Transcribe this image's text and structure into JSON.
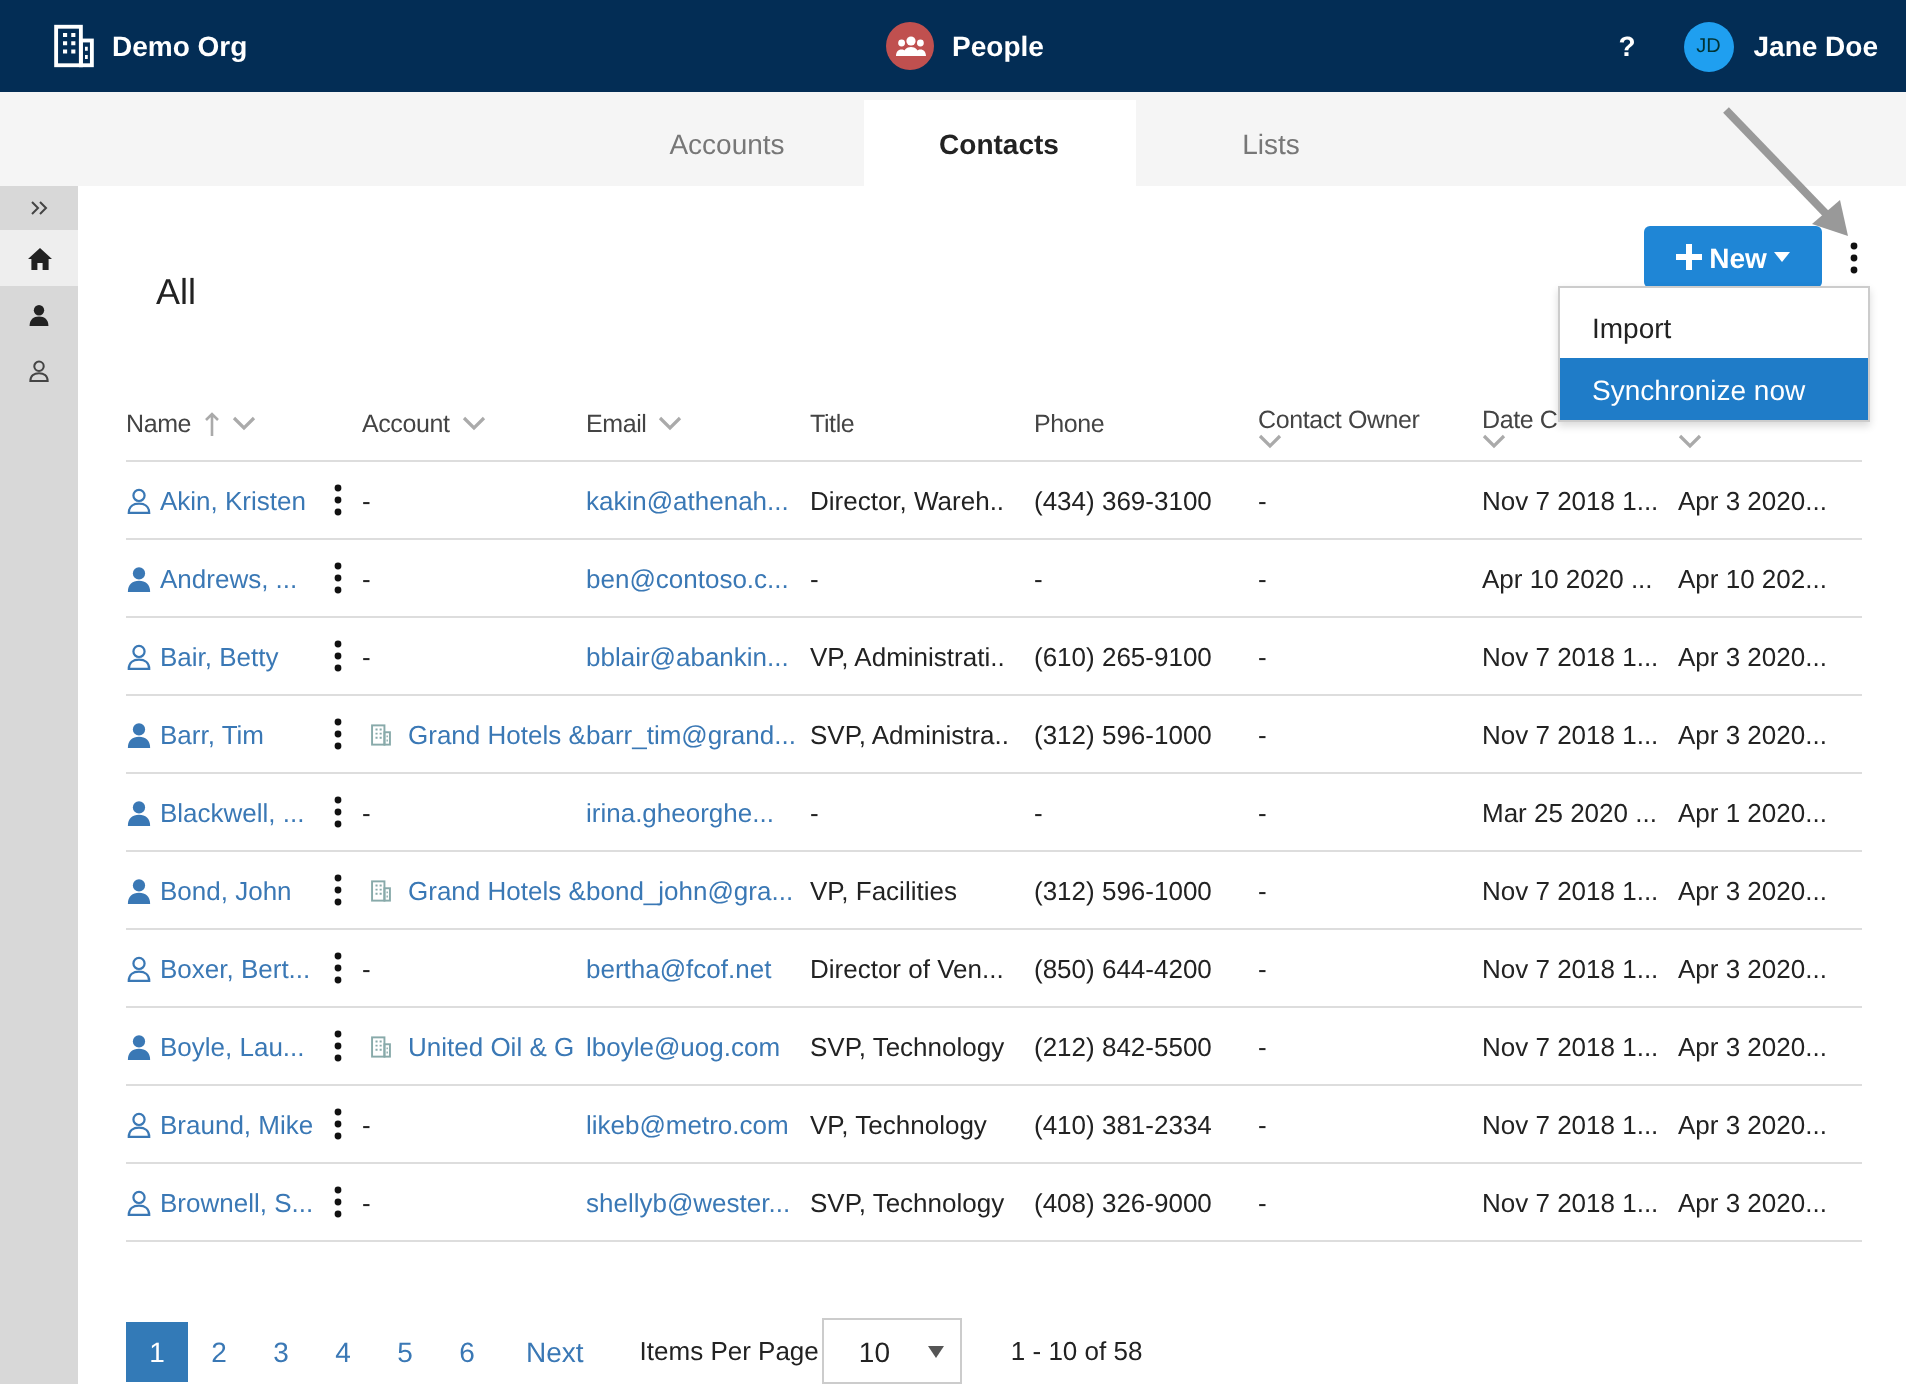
{
  "header": {
    "org": "Demo Org",
    "app": "People",
    "help": "?",
    "user": {
      "initials": "JD",
      "name": "Jane Doe"
    }
  },
  "tabs": [
    {
      "label": "Accounts",
      "selected": false
    },
    {
      "label": "Contacts",
      "selected": true
    },
    {
      "label": "Lists",
      "selected": false
    }
  ],
  "sidebar": {
    "items": [
      {
        "kind": "expand",
        "selected": false
      },
      {
        "kind": "home",
        "selected": true
      },
      {
        "kind": "person",
        "selected": false
      },
      {
        "kind": "person-outline",
        "selected": false
      }
    ]
  },
  "view_title": "All",
  "new_button": "New",
  "more_menu": {
    "items": [
      {
        "label": "Import",
        "selected": false
      },
      {
        "label": "Synchronize now",
        "selected": true
      }
    ]
  },
  "table": {
    "columns": [
      {
        "label": "Name",
        "sorted_ascending": true,
        "menu": true,
        "stacked": false
      },
      {
        "label": "Account",
        "sorted_ascending": false,
        "menu": true,
        "stacked": false
      },
      {
        "label": "Email",
        "sorted_ascending": false,
        "menu": true,
        "stacked": false
      },
      {
        "label": "Title",
        "sorted_ascending": false,
        "menu": false,
        "stacked": false
      },
      {
        "label": "Phone",
        "sorted_ascending": false,
        "menu": false,
        "stacked": false
      },
      {
        "label": "Contact Owner",
        "sorted_ascending": false,
        "menu": true,
        "stacked": true
      },
      {
        "label": "Date C",
        "sorted_ascending": false,
        "menu": true,
        "stacked": true
      },
      {
        "sorted_ascending": false,
        "menu": true,
        "stacked": true
      }
    ],
    "rows": [
      {
        "kind": "outline",
        "name": "Akin, Kristen",
        "account": "-",
        "account_linked": false,
        "email": "kakin@athenah...",
        "title": "Director, Wareh..",
        "phone": "(434) 369-3100",
        "owner": "-",
        "created": "Nov 7 2018 1...",
        "modified": "Apr 3 2020..."
      },
      {
        "kind": "filled",
        "name": "Andrews, ...",
        "account": "-",
        "account_linked": false,
        "email": "ben@contoso.c...",
        "title": "-",
        "phone": "-",
        "owner": "-",
        "created": "Apr 10 2020 ...",
        "modified": "Apr 10 202..."
      },
      {
        "kind": "outline",
        "name": "Bair, Betty",
        "account": "-",
        "account_linked": false,
        "email": "bblair@abankin...",
        "title": "VP, Administrati..",
        "phone": "(610) 265-9100",
        "owner": "-",
        "created": "Nov 7 2018 1...",
        "modified": "Apr 3 2020..."
      },
      {
        "kind": "filled",
        "name": "Barr, Tim",
        "account": "Grand Hotels &",
        "account_linked": true,
        "email": "barr_tim@grand...",
        "title": "SVP, Administra..",
        "phone": "(312) 596-1000",
        "owner": "-",
        "created": "Nov 7 2018 1...",
        "modified": "Apr 3 2020..."
      },
      {
        "kind": "filled",
        "name": "Blackwell, ...",
        "account": "-",
        "account_linked": false,
        "email": "irina.gheorghe...",
        "title": "-",
        "phone": "-",
        "owner": "-",
        "created": "Mar 25 2020 ...",
        "modified": "Apr 1 2020..."
      },
      {
        "kind": "filled",
        "name": "Bond, John",
        "account": "Grand Hotels &",
        "account_linked": true,
        "email": "bond_john@gra...",
        "title": "VP, Facilities",
        "phone": "(312) 596-1000",
        "owner": "-",
        "created": "Nov 7 2018 1...",
        "modified": "Apr 3 2020..."
      },
      {
        "kind": "outline",
        "name": "Boxer, Bert...",
        "account": "-",
        "account_linked": false,
        "email": "bertha@fcof.net",
        "title": "Director of Ven...",
        "phone": "(850) 644-4200",
        "owner": "-",
        "created": "Nov 7 2018 1...",
        "modified": "Apr 3 2020..."
      },
      {
        "kind": "filled",
        "name": "Boyle, Lau...",
        "account": "United Oil & G",
        "account_linked": true,
        "email": "lboyle@uog.com",
        "title": "SVP, Technology",
        "phone": "(212) 842-5500",
        "owner": "-",
        "created": "Nov 7 2018 1...",
        "modified": "Apr 3 2020..."
      },
      {
        "kind": "outline",
        "name": "Braund, Mike",
        "account": "-",
        "account_linked": false,
        "email": "likeb@metro.com",
        "title": "VP, Technology",
        "phone": "(410) 381-2334",
        "owner": "-",
        "created": "Nov 7 2018 1...",
        "modified": "Apr 3 2020..."
      },
      {
        "kind": "outline",
        "name": "Brownell, S...",
        "account": "-",
        "account_linked": false,
        "email": "shellyb@wester...",
        "title": "SVP, Technology",
        "phone": "(408) 326-9000",
        "owner": "-",
        "created": "Nov 7 2018 1...",
        "modified": "Apr 3 2020..."
      }
    ]
  },
  "pagination": {
    "pages": [
      {
        "label": "1",
        "selected": true
      },
      {
        "label": "2",
        "selected": false
      },
      {
        "label": "3",
        "selected": false
      },
      {
        "label": "4",
        "selected": false
      },
      {
        "label": "5",
        "selected": false
      },
      {
        "label": "6",
        "selected": false
      }
    ],
    "next": "Next",
    "per_page_label": "Items Per Page",
    "per_page": "10",
    "range": "1 - 10 of 58"
  }
}
